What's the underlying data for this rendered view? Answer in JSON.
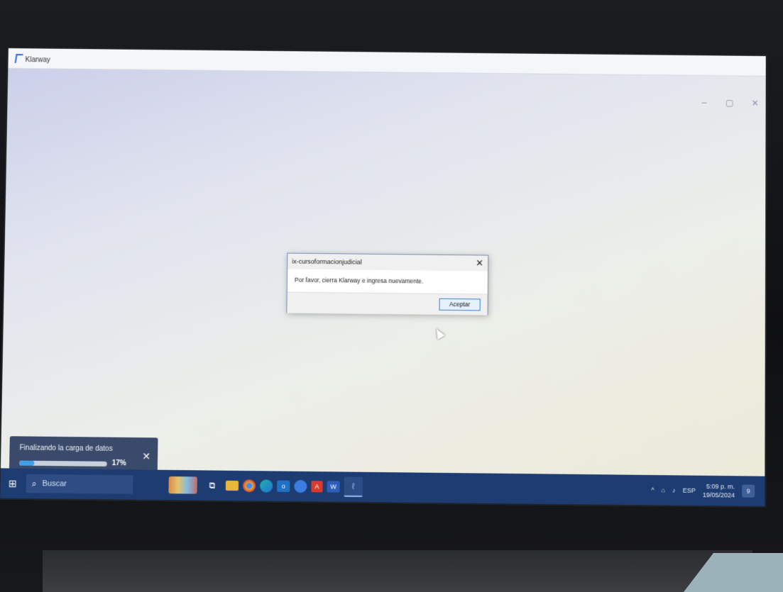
{
  "window": {
    "app_title": "Klarway",
    "minimize": "–",
    "maximize": "▢",
    "close": "✕"
  },
  "dialog": {
    "title": "ix-cursoformacionjudicial",
    "close": "✕",
    "message": "Por favor, cierra Klarway e ingresa nuevamente.",
    "button": "Aceptar"
  },
  "toast": {
    "text": "Finalizando la carga de datos",
    "progress_percent": 17,
    "progress_label": "17%",
    "close": "✕"
  },
  "taskbar": {
    "search_placeholder": "Buscar",
    "icons": [
      "task-view-icon",
      "file-explorer-icon",
      "chrome-icon",
      "edge-icon",
      "outlook-icon",
      "app-icon",
      "acrobat-icon",
      "word-icon",
      "klarway-icon"
    ],
    "tray": {
      "chevron": "^",
      "language": "ESP",
      "time": "5:09 p. m.",
      "date": "19/05/2024",
      "notifications": "9"
    }
  },
  "colors": {
    "taskbar": "#1d3c72",
    "toast": "#3a4a6b",
    "progress": "#3fa0ea",
    "button_border": "#3c7fd9"
  }
}
